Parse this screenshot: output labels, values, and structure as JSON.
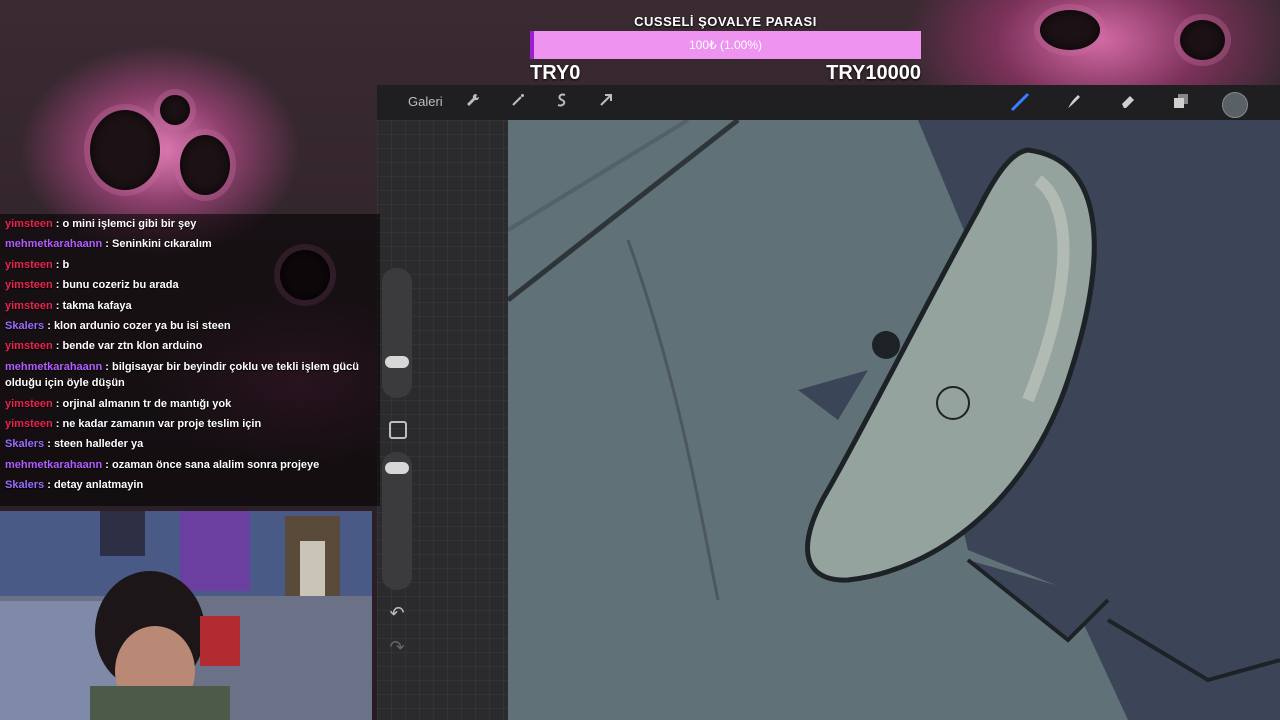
{
  "goal": {
    "title": "CUSSELİ ŞOVALYE PARASI",
    "progress_text": "100₺ (1.00%)",
    "progress_fraction": 0.01,
    "min_label": "TRY0",
    "max_label": "TRY10000",
    "bar_color": "#ee94f0",
    "fill_color": "#9b1fd0"
  },
  "toolbar": {
    "gallery_label": "Galeri",
    "icons": [
      "wrench-icon",
      "magic-wand-icon",
      "selection-icon",
      "transform-arrow-icon",
      "brush-icon",
      "smudge-icon",
      "eraser-icon",
      "layers-icon",
      "color-swatch-icon"
    ]
  },
  "chat": {
    "messages": [
      {
        "user": "yimsteen",
        "color": "#e8254f",
        "text": "o mini işlemci gibi bir şey"
      },
      {
        "user": "mehmetkarahaann",
        "color": "#b35cff",
        "text": "Seninkini cıkaralım"
      },
      {
        "user": "yimsteen",
        "color": "#e8254f",
        "text": "b"
      },
      {
        "user": "yimsteen",
        "color": "#e8254f",
        "text": "bunu cozeriz bu arada"
      },
      {
        "user": "yimsteen",
        "color": "#e8254f",
        "text": "takma kafaya"
      },
      {
        "user": "Skalers",
        "color": "#9c6bff",
        "text": "klon ardunio cozer ya bu isi steen"
      },
      {
        "user": "yimsteen",
        "color": "#e8254f",
        "text": "bende var ztn klon arduino"
      },
      {
        "user": "mehmetkarahaann",
        "color": "#b35cff",
        "text": "bilgisayar bir beyindir çoklu ve tekli işlem gücü olduğu için öyle düşün"
      },
      {
        "user": "yimsteen",
        "color": "#e8254f",
        "text": "orjinal almanın tr de mantığı yok"
      },
      {
        "user": "yimsteen",
        "color": "#e8254f",
        "text": "ne kadar zamanın var proje teslim için"
      },
      {
        "user": "Skalers",
        "color": "#9c6bff",
        "text": "steen halleder ya"
      },
      {
        "user": "mehmetkarahaann",
        "color": "#b35cff",
        "text": "ozaman önce sana alalim sonra projeye"
      },
      {
        "user": "Skalers",
        "color": "#9c6bff",
        "text": "detay anlatmayin"
      }
    ]
  }
}
